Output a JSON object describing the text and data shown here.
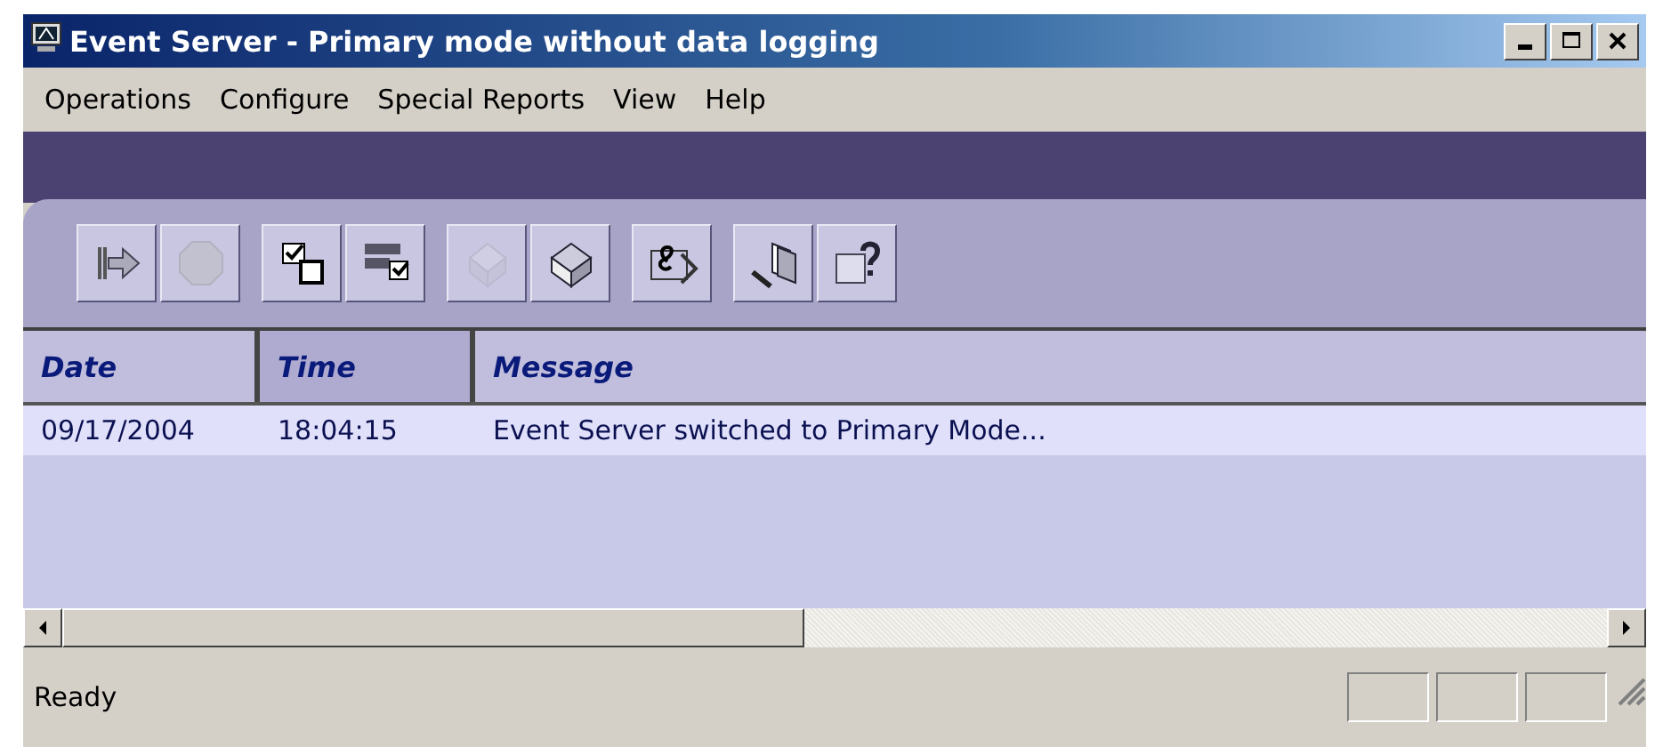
{
  "window": {
    "title": "Event Server - Primary mode without data logging"
  },
  "menu": [
    "Operations",
    "Configure",
    "Special Reports",
    "View",
    "Help"
  ],
  "toolbar": [
    [
      {
        "kind": "exit",
        "disabled": false
      },
      {
        "kind": "stop",
        "disabled": true
      }
    ],
    [
      {
        "kind": "checkcopy",
        "disabled": false
      },
      {
        "kind": "checklist",
        "disabled": false
      }
    ],
    [
      {
        "kind": "cube",
        "disabled": true
      },
      {
        "kind": "cubeopen",
        "disabled": false
      }
    ],
    [
      {
        "kind": "ampersand",
        "disabled": false
      }
    ],
    [
      {
        "kind": "pen",
        "disabled": false
      },
      {
        "kind": "help",
        "disabled": false
      }
    ]
  ],
  "table": {
    "columns": [
      {
        "label": "Date",
        "selected": false
      },
      {
        "label": "Time",
        "selected": true
      },
      {
        "label": "Message",
        "selected": false
      }
    ],
    "rows": [
      {
        "cells": [
          "09/17/2004",
          "18:04:15",
          "Event Server switched to Primary Mode..."
        ],
        "selected": true
      }
    ]
  },
  "scrollbar": {
    "level": 0.48
  },
  "status_bar": {
    "text": "Ready"
  }
}
